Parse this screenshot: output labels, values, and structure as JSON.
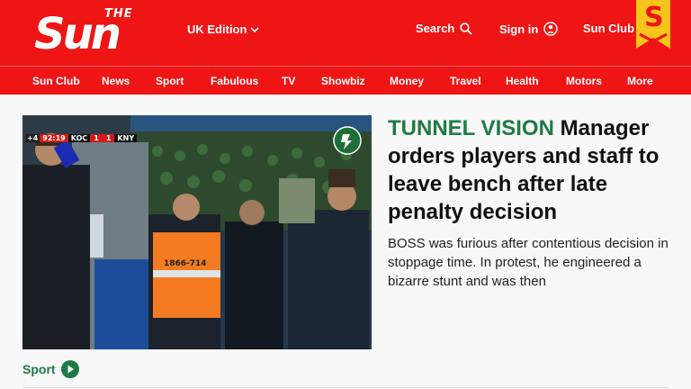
{
  "header": {
    "logo_small": "THE",
    "logo_main": "Sun",
    "edition_label": "UK Edition",
    "search_label": "Search",
    "signin_label": "Sign in",
    "sunclub_label": "Sun Club",
    "ribbon_letter": "S"
  },
  "nav": {
    "items": [
      "Sun Club",
      "News",
      "Sport",
      "Fabulous",
      "TV",
      "Showbiz",
      "Money",
      "Travel",
      "Health",
      "Motors",
      "More"
    ]
  },
  "article": {
    "kicker": "TUNNEL VISION",
    "headline": " Manager orders players and staff to leave bench after late penalty decision",
    "summary": "BOSS was furious after contentious decision in stoppage time. In protest, he engineered a bizarre stunt and was then",
    "section_label": "Sport"
  },
  "scoreboard": {
    "prefix": "+4",
    "time": "92:19",
    "home": "KOC",
    "home_score": "1",
    "away_score": "1",
    "away": "KNY"
  },
  "vest_text": "1866-714",
  "colors": {
    "brand_red": "#ef1515",
    "sport_green": "#1e7a45",
    "ribbon_yellow": "#f7c51a"
  },
  "icons": {
    "search": "magnifier",
    "signin": "user-circle",
    "edition_dropdown": "chevron-down",
    "section_link": "play-circle"
  }
}
